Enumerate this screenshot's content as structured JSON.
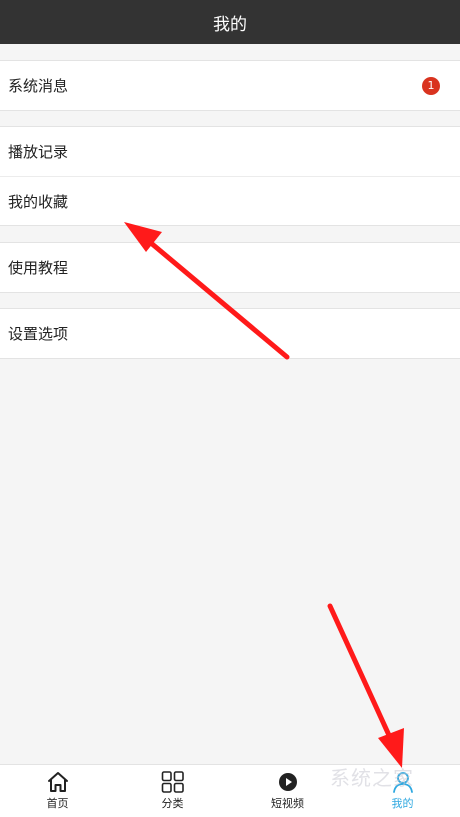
{
  "header": {
    "title": "我的"
  },
  "groups": [
    {
      "items": [
        {
          "label": "系统消息",
          "badge": "1"
        }
      ]
    },
    {
      "items": [
        {
          "label": "播放记录"
        },
        {
          "label": "我的收藏"
        }
      ]
    },
    {
      "items": [
        {
          "label": "使用教程"
        }
      ]
    },
    {
      "items": [
        {
          "label": "设置选项"
        }
      ]
    }
  ],
  "tabbar": {
    "tabs": [
      {
        "label": "首页",
        "icon": "home-icon"
      },
      {
        "label": "分类",
        "icon": "grid-icon"
      },
      {
        "label": "短视频",
        "icon": "video-icon"
      },
      {
        "label": "我的",
        "icon": "user-icon",
        "active": true
      }
    ],
    "active_color": "#2fa8e0"
  },
  "colors": {
    "titlebar": "#333333",
    "badge": "#d9331f",
    "annotation_arrow": "#ff1a1a"
  },
  "watermark": "系统之家"
}
